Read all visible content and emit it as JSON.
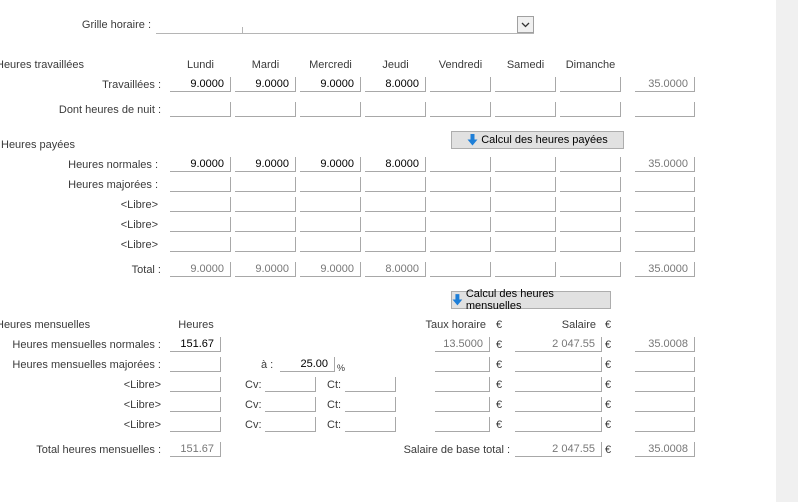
{
  "grid": {
    "label": "Grille horaire :",
    "value": ""
  },
  "worked": {
    "section": "Heures travaillées",
    "days": [
      "Lundi",
      "Mardi",
      "Mercredi",
      "Jeudi",
      "Vendredi",
      "Samedi",
      "Dimanche"
    ],
    "rows": [
      {
        "label": "Travaillées :",
        "values": [
          "9.0000",
          "9.0000",
          "9.0000",
          "8.0000",
          "",
          "",
          ""
        ],
        "total": "35.0000"
      },
      {
        "label": "Dont heures de nuit :",
        "values": [
          "",
          "",
          "",
          "",
          "",
          "",
          ""
        ],
        "total": ""
      }
    ]
  },
  "paid": {
    "section": "Heures payées",
    "calc_button": "Calcul des heures payées",
    "rows": [
      {
        "label": "Heures normales :",
        "values": [
          "9.0000",
          "9.0000",
          "9.0000",
          "8.0000",
          "",
          "",
          ""
        ],
        "total": "35.0000"
      },
      {
        "label": "Heures majorées :",
        "values": [
          "",
          "",
          "",
          "",
          "",
          "",
          ""
        ],
        "total": ""
      },
      {
        "label": "<Libre>",
        "values": [
          "",
          "",
          "",
          "",
          "",
          "",
          ""
        ],
        "total": ""
      },
      {
        "label": "<Libre>",
        "values": [
          "",
          "",
          "",
          "",
          "",
          "",
          ""
        ],
        "total": ""
      },
      {
        "label": "<Libre>",
        "values": [
          "",
          "",
          "",
          "",
          "",
          "",
          ""
        ],
        "total": ""
      }
    ],
    "total_row": {
      "label": "Total :",
      "values": [
        "9.0000",
        "9.0000",
        "9.0000",
        "8.0000",
        "",
        "",
        ""
      ],
      "total": "35.0000"
    }
  },
  "monthly": {
    "section": "Heures mensuelles",
    "calc_button": "Calcul des heures mensuelles",
    "col_hours": "Heures",
    "col_rate": "Taux horaire",
    "col_salary": "Salaire",
    "currency": "€",
    "rate_at_label": "à :",
    "percent": "%",
    "cv_label": "Cv:",
    "ct_label": "Ct:",
    "normal": {
      "label": "Heures mensuelles normales :",
      "hours": "151.67",
      "rate": "13.5000",
      "salary": "2 047.55",
      "extra": "35.0008"
    },
    "overtime": {
      "label": "Heures mensuelles majorées :",
      "hours": "",
      "pct": "25.00",
      "rate": "",
      "salary": "",
      "extra": ""
    },
    "free": [
      {
        "label": "<Libre>",
        "hours": "",
        "cv": "",
        "ct": "",
        "rate": "",
        "salary": "",
        "extra": ""
      },
      {
        "label": "<Libre>",
        "hours": "",
        "cv": "",
        "ct": "",
        "rate": "",
        "salary": "",
        "extra": ""
      },
      {
        "label": "<Libre>",
        "hours": "",
        "cv": "",
        "ct": "",
        "rate": "",
        "salary": "",
        "extra": ""
      }
    ],
    "total": {
      "label": "Total heures mensuelles :",
      "hours": "151.67",
      "base_label": "Salaire de base total :",
      "salary": "2 047.55",
      "extra": "35.0008"
    }
  },
  "colors": {
    "button_bg": "#e1e1e1",
    "arrow": "#1e7fd8",
    "panel": "#f0f0f0"
  }
}
